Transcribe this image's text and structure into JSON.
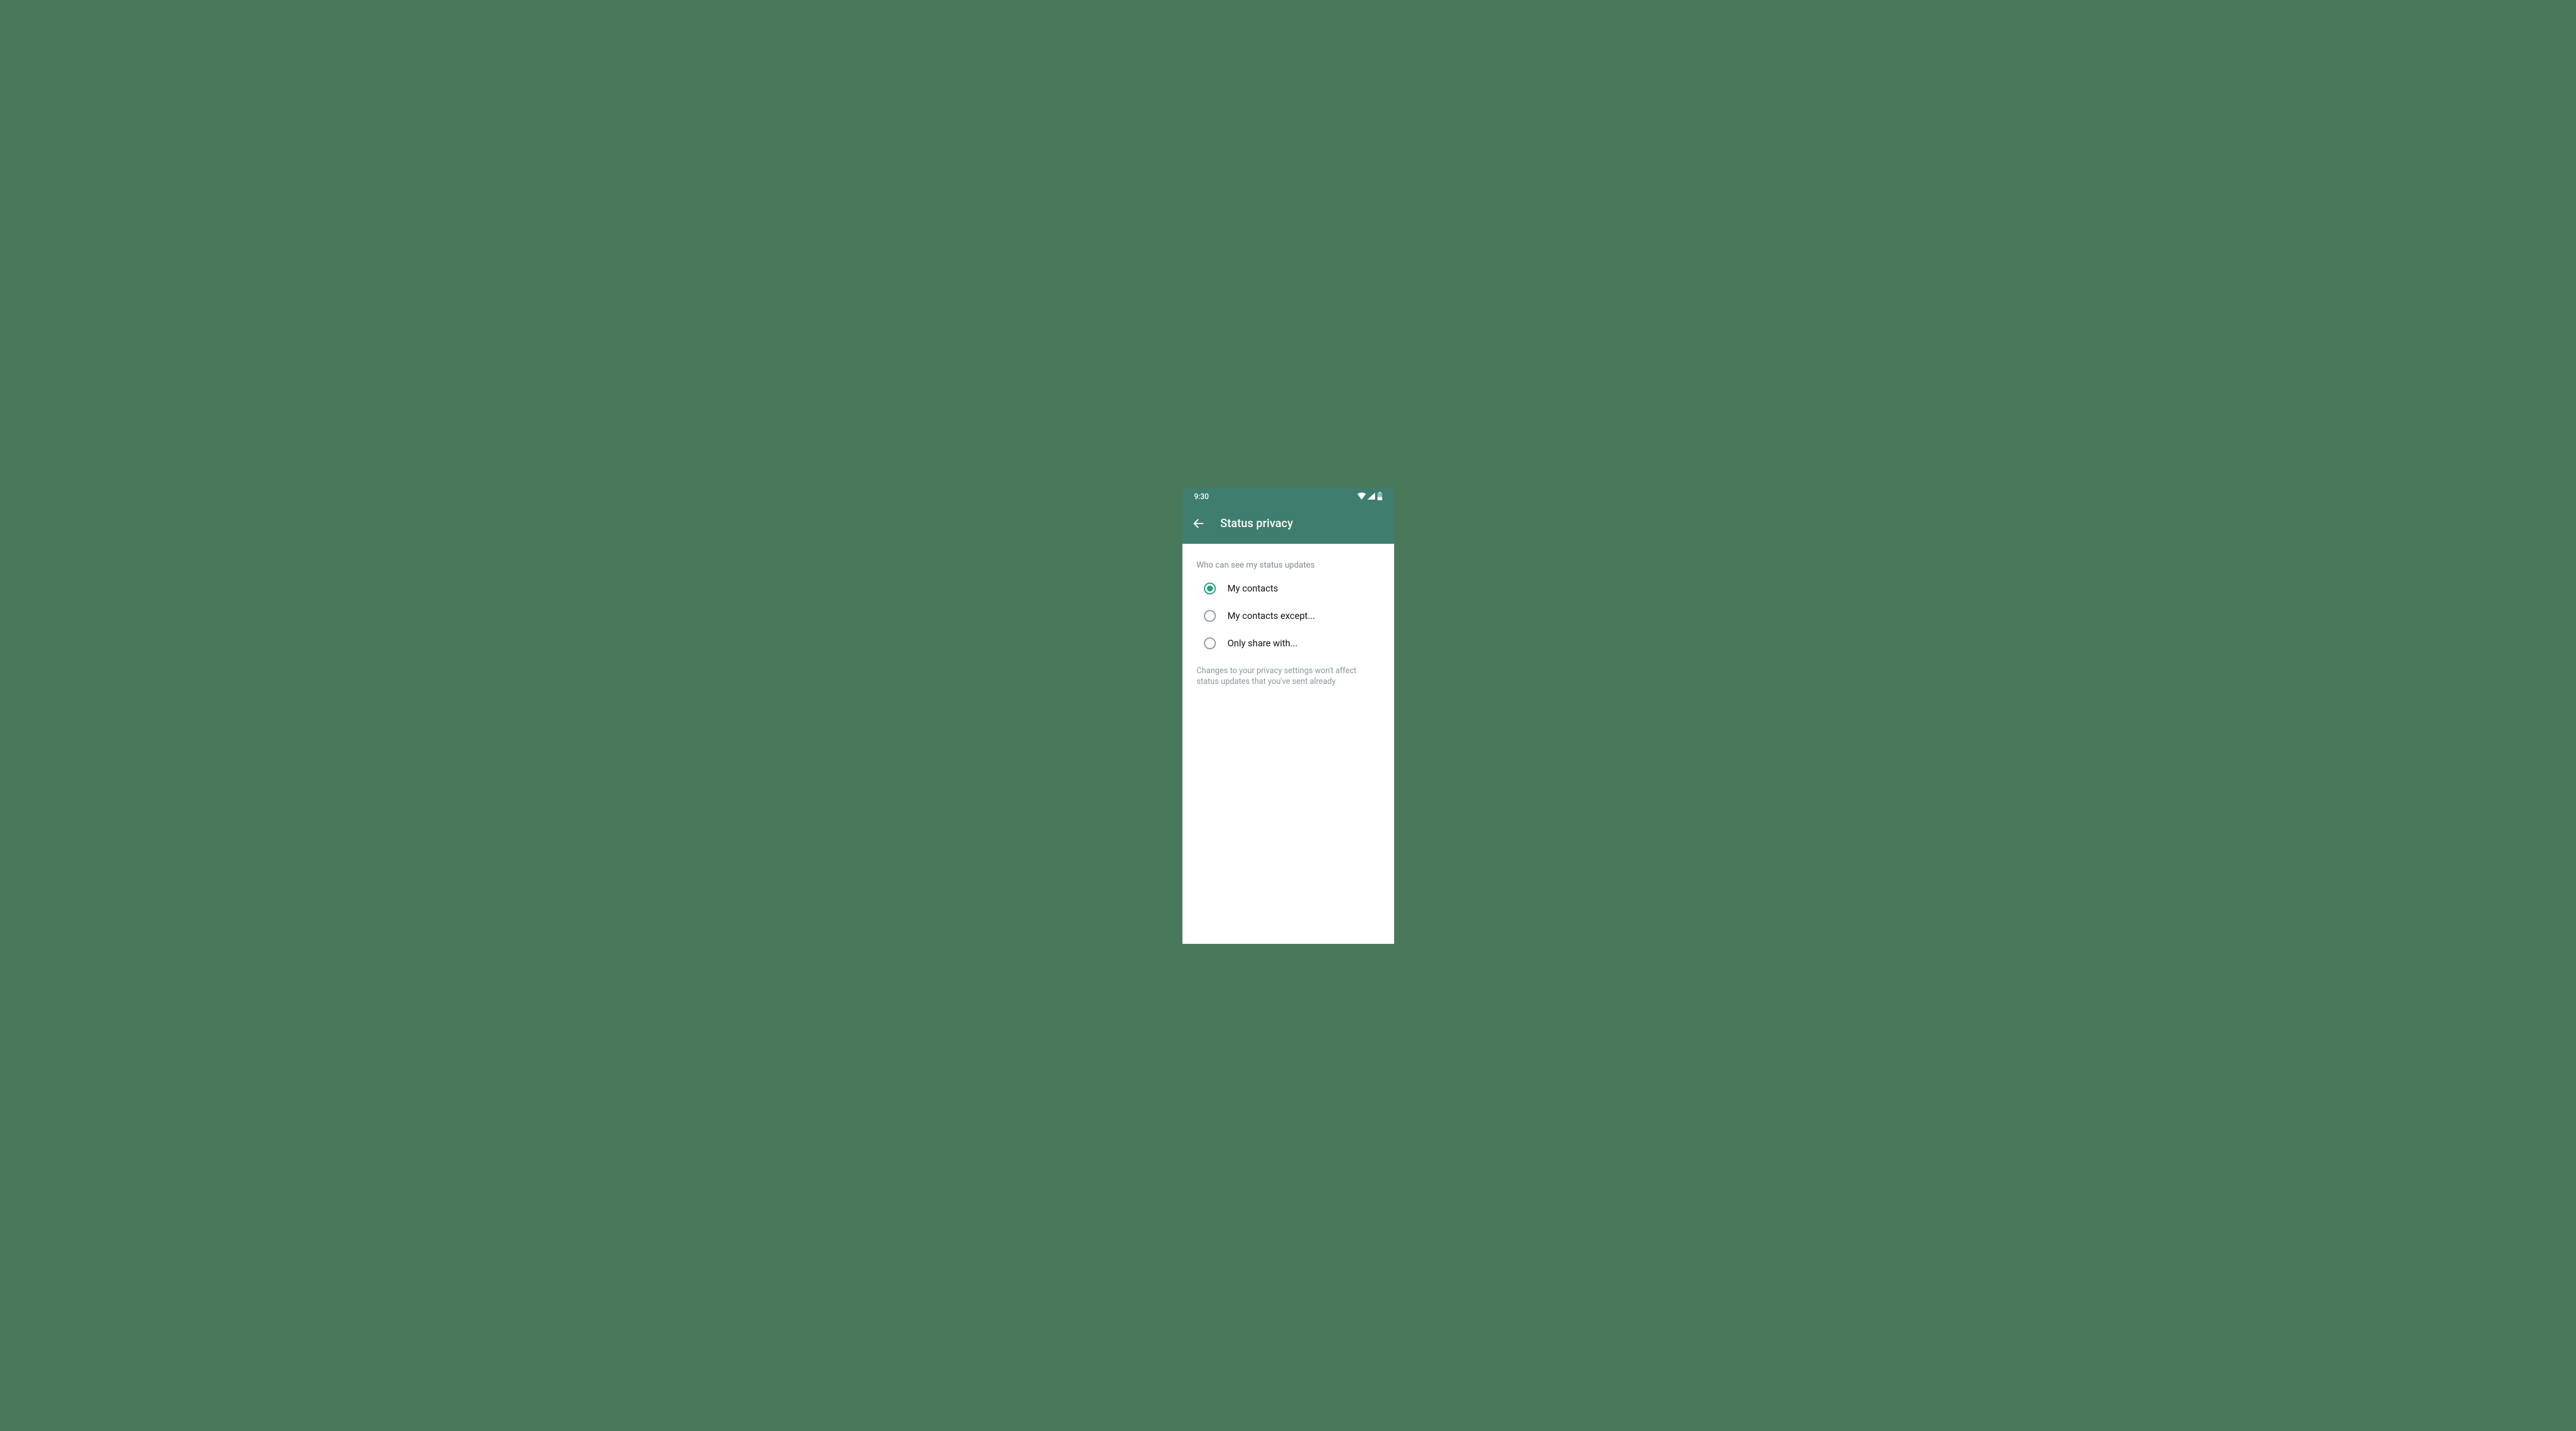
{
  "statusbar": {
    "time": "9:30"
  },
  "header": {
    "title": "Status privacy"
  },
  "section": {
    "label": "Who can see my status updates"
  },
  "options": [
    {
      "label": "My contacts",
      "selected": true
    },
    {
      "label": "My contacts except...",
      "selected": false
    },
    {
      "label": "Only share with...",
      "selected": false
    }
  ],
  "note": "Changes to your privacy settings won't affect status updates that you've sent already"
}
